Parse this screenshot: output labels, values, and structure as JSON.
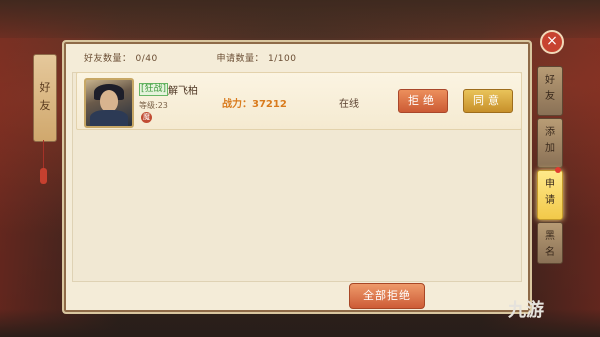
{
  "sidebar_left": {
    "label": "好\n友"
  },
  "stats": {
    "friend_count_label": "好友数量：",
    "friend_count_value": "0/40",
    "request_count_label": "申请数量：",
    "request_count_value": "1/100"
  },
  "requests": [
    {
      "tag": "[狂战]",
      "name": "解飞柏",
      "level": "等级:23",
      "seal": "魔",
      "power_label": "战力：",
      "power_value": "37212",
      "status": "在线",
      "reject_label": "拒绝",
      "accept_label": "同意"
    }
  ],
  "footer": {
    "reject_all_label": "全部拒绝"
  },
  "right_tabs": [
    {
      "label": "好\n友",
      "active": false
    },
    {
      "label": "添\n加",
      "active": false
    },
    {
      "label": "申\n请",
      "active": true
    },
    {
      "label": "黑\n名",
      "active": false
    }
  ],
  "close_icon": "×",
  "watermark": "九游",
  "colors": {
    "panel_bg": "#f4ecd8",
    "reject_btn": "#cc5b35",
    "accept_btn": "#c7902a",
    "power_text": "#d97b1d",
    "active_tab": "#f2c94a"
  }
}
